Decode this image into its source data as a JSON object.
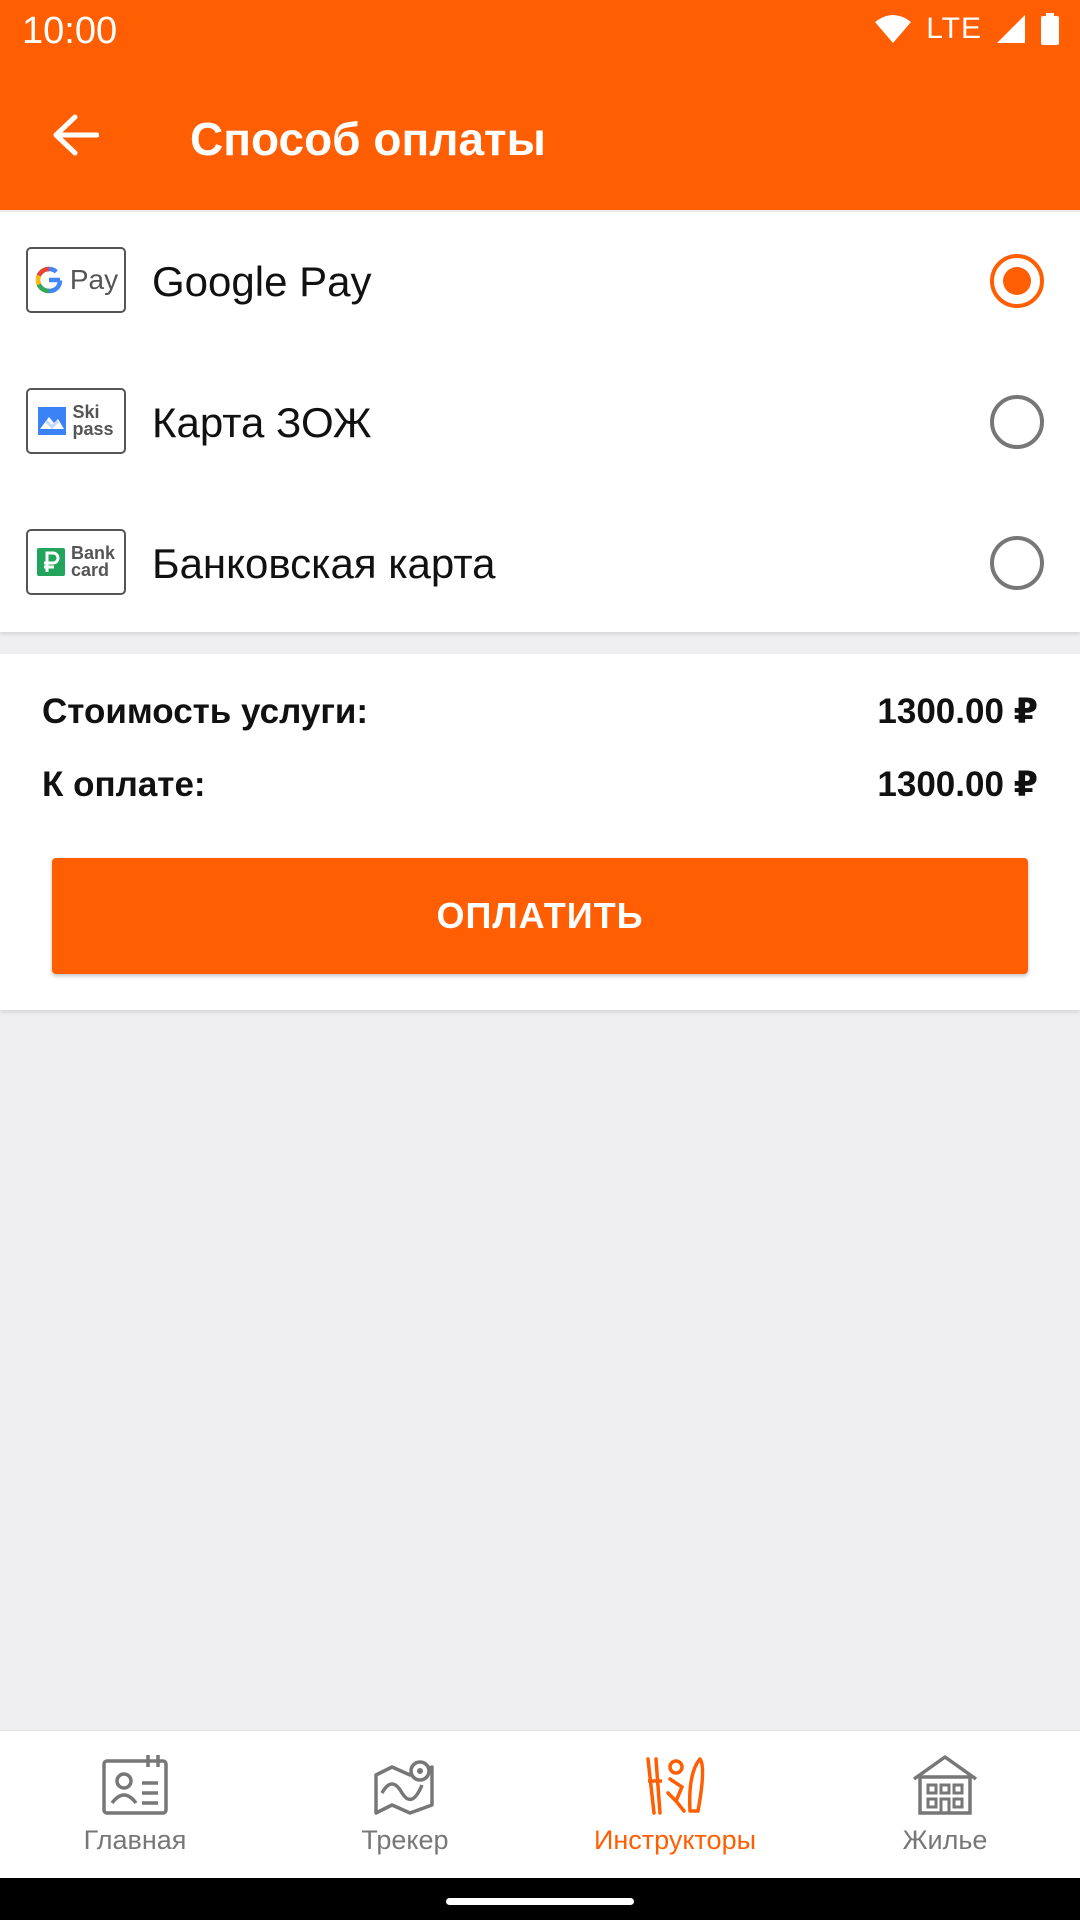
{
  "status_bar": {
    "time": "10:00",
    "network": "LTE"
  },
  "header": {
    "title": "Способ оплаты"
  },
  "payment_methods": [
    {
      "label": "Google Pay",
      "logo": "google-pay-logo",
      "logo_text": "Pay",
      "selected": true
    },
    {
      "label": "Карта ЗОЖ",
      "logo": "ski-pass-logo",
      "logo_text_top": "Ski",
      "logo_text_bottom": "pass",
      "selected": false
    },
    {
      "label": "Банковская карта",
      "logo": "bank-card-logo",
      "logo_text_top": "Bank",
      "logo_text_bottom": "card",
      "selected": false
    }
  ],
  "summary": {
    "service_cost_label": "Стоимость услуги:",
    "service_cost_value": "1300.00 ₽",
    "to_pay_label": "К оплате:",
    "to_pay_value": "1300.00 ₽",
    "pay_button": "ОПЛАТИТЬ"
  },
  "bottom_nav": [
    {
      "label": "Главная",
      "icon": "id-card-icon",
      "active": false
    },
    {
      "label": "Трекер",
      "icon": "map-route-icon",
      "active": false
    },
    {
      "label": "Инструкторы",
      "icon": "ski-icon",
      "active": true
    },
    {
      "label": "Жилье",
      "icon": "building-icon",
      "active": false
    }
  ],
  "colors": {
    "accent": "#ff5e03",
    "background": "#efeff1",
    "inactive": "#777777"
  }
}
